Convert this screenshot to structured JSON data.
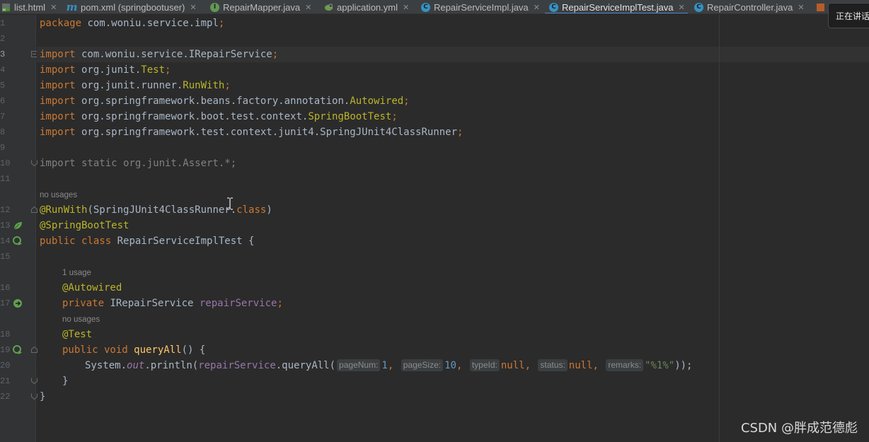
{
  "tabs": [
    {
      "label": "list.html",
      "icon": "html-file-icon",
      "active": false
    },
    {
      "label": "pom.xml (springbootuser)",
      "icon": "maven-file-icon",
      "active": false
    },
    {
      "label": "RepairMapper.java",
      "icon": "interface-file-icon",
      "active": false
    },
    {
      "label": "application.yml",
      "icon": "spring-config-file-icon",
      "active": false
    },
    {
      "label": "RepairServiceImpl.java",
      "icon": "class-file-icon",
      "active": false
    },
    {
      "label": "RepairServiceImplTest.java",
      "icon": "test-class-file-icon",
      "active": true
    },
    {
      "label": "RepairController.java",
      "icon": "class-file-icon",
      "active": false
    }
  ],
  "tooltip": "正在讲话",
  "line_numbers": [
    "1",
    "2",
    "3",
    "4",
    "5",
    "6",
    "7",
    "8",
    "9",
    "10",
    "11",
    "12",
    "13",
    "14",
    "15",
    "16",
    "17",
    "18",
    "19",
    "20",
    "21",
    "22"
  ],
  "hints": {
    "no_usages_1": "no usages",
    "one_usage": "1 usage",
    "no_usages_2": "no usages"
  },
  "code": {
    "l1_kw": "package",
    "l1_rest": " com.woniu.service.impl",
    "l1_semi": ";",
    "l3_kw": "import",
    "l3_pkg": " com.woniu.service.IRepairService",
    "l3_semi": ";",
    "l4_kw": "import",
    "l4_pkg": " org.junit.",
    "l4_cls": "Test",
    "l4_semi": ";",
    "l5_kw": "import",
    "l5_pkg": " org.junit.runner.",
    "l5_cls": "RunWith",
    "l5_semi": ";",
    "l6_kw": "import",
    "l6_pkg": " org.springframework.beans.factory.annotation.",
    "l6_cls": "Autowired",
    "l6_semi": ";",
    "l7_kw": "import",
    "l7_pkg": " org.springframework.boot.test.context.",
    "l7_cls": "SpringBootTest",
    "l7_semi": ";",
    "l8_kw": "import",
    "l8_pkg": " org.springframework.test.context.junit4.SpringJUnit4ClassRunner",
    "l8_semi": ";",
    "l10": "import static org.junit.Assert.*;",
    "l12_ann": "@RunWith",
    "l12_rest": "(SpringJUnit4ClassRunner.",
    "l12_kw": "class",
    "l12_end": ")",
    "l13_ann": "@SpringBootTest",
    "l14_kw": "public class",
    "l14_rest": " RepairServiceImplTest {",
    "l16_ann": "@Autowired",
    "l17_kw": "private",
    "l17_type": " IRepairService ",
    "l17_fld": "repairService",
    "l17_semi": ";",
    "l18_ann": "@Test",
    "l19_kw": "public void",
    "l19_fn": " queryAll",
    "l19_rest": "() {",
    "l20_a": "System.",
    "l20_out": "out",
    "l20_b": ".println(",
    "l20_fld": "repairService",
    "l20_c": ".queryAll(",
    "l20_p1": "pageNum:",
    "l20_v1": "1",
    "l20_p2": "pageSize:",
    "l20_v2": "10",
    "l20_p3": "typeId:",
    "l20_v3": "null",
    "l20_p4": "status:",
    "l20_v4": "null",
    "l20_p5": "remarks:",
    "l20_v5": "\"%1%\"",
    "l20_end": "));",
    "comma": ", ",
    "l21": "}",
    "l22": "}"
  },
  "watermark": "CSDN @胖成范德彪",
  "colors": {
    "keyword": "#cc7832",
    "annotation": "#bbb529",
    "field": "#9876aa",
    "number": "#6897bb",
    "string": "#6a8759",
    "method": "#ffc66d",
    "background": "#2b2b2b"
  }
}
